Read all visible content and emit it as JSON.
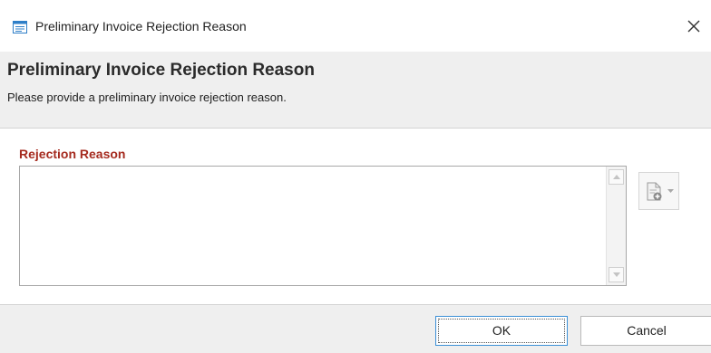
{
  "window": {
    "title": "Preliminary Invoice Rejection Reason",
    "icon": "form-window-icon",
    "close_icon": "close-icon"
  },
  "header": {
    "heading": "Preliminary Invoice Rejection Reason",
    "description": "Please provide a preliminary invoice rejection reason."
  },
  "form": {
    "rejection_reason_label": "Rejection Reason",
    "rejection_reason_value": "",
    "attach_icon": "add-document-icon",
    "label_color": "#a52a1e"
  },
  "footer": {
    "ok_label": "OK",
    "cancel_label": "Cancel",
    "focus_color": "#3b8fd6"
  }
}
